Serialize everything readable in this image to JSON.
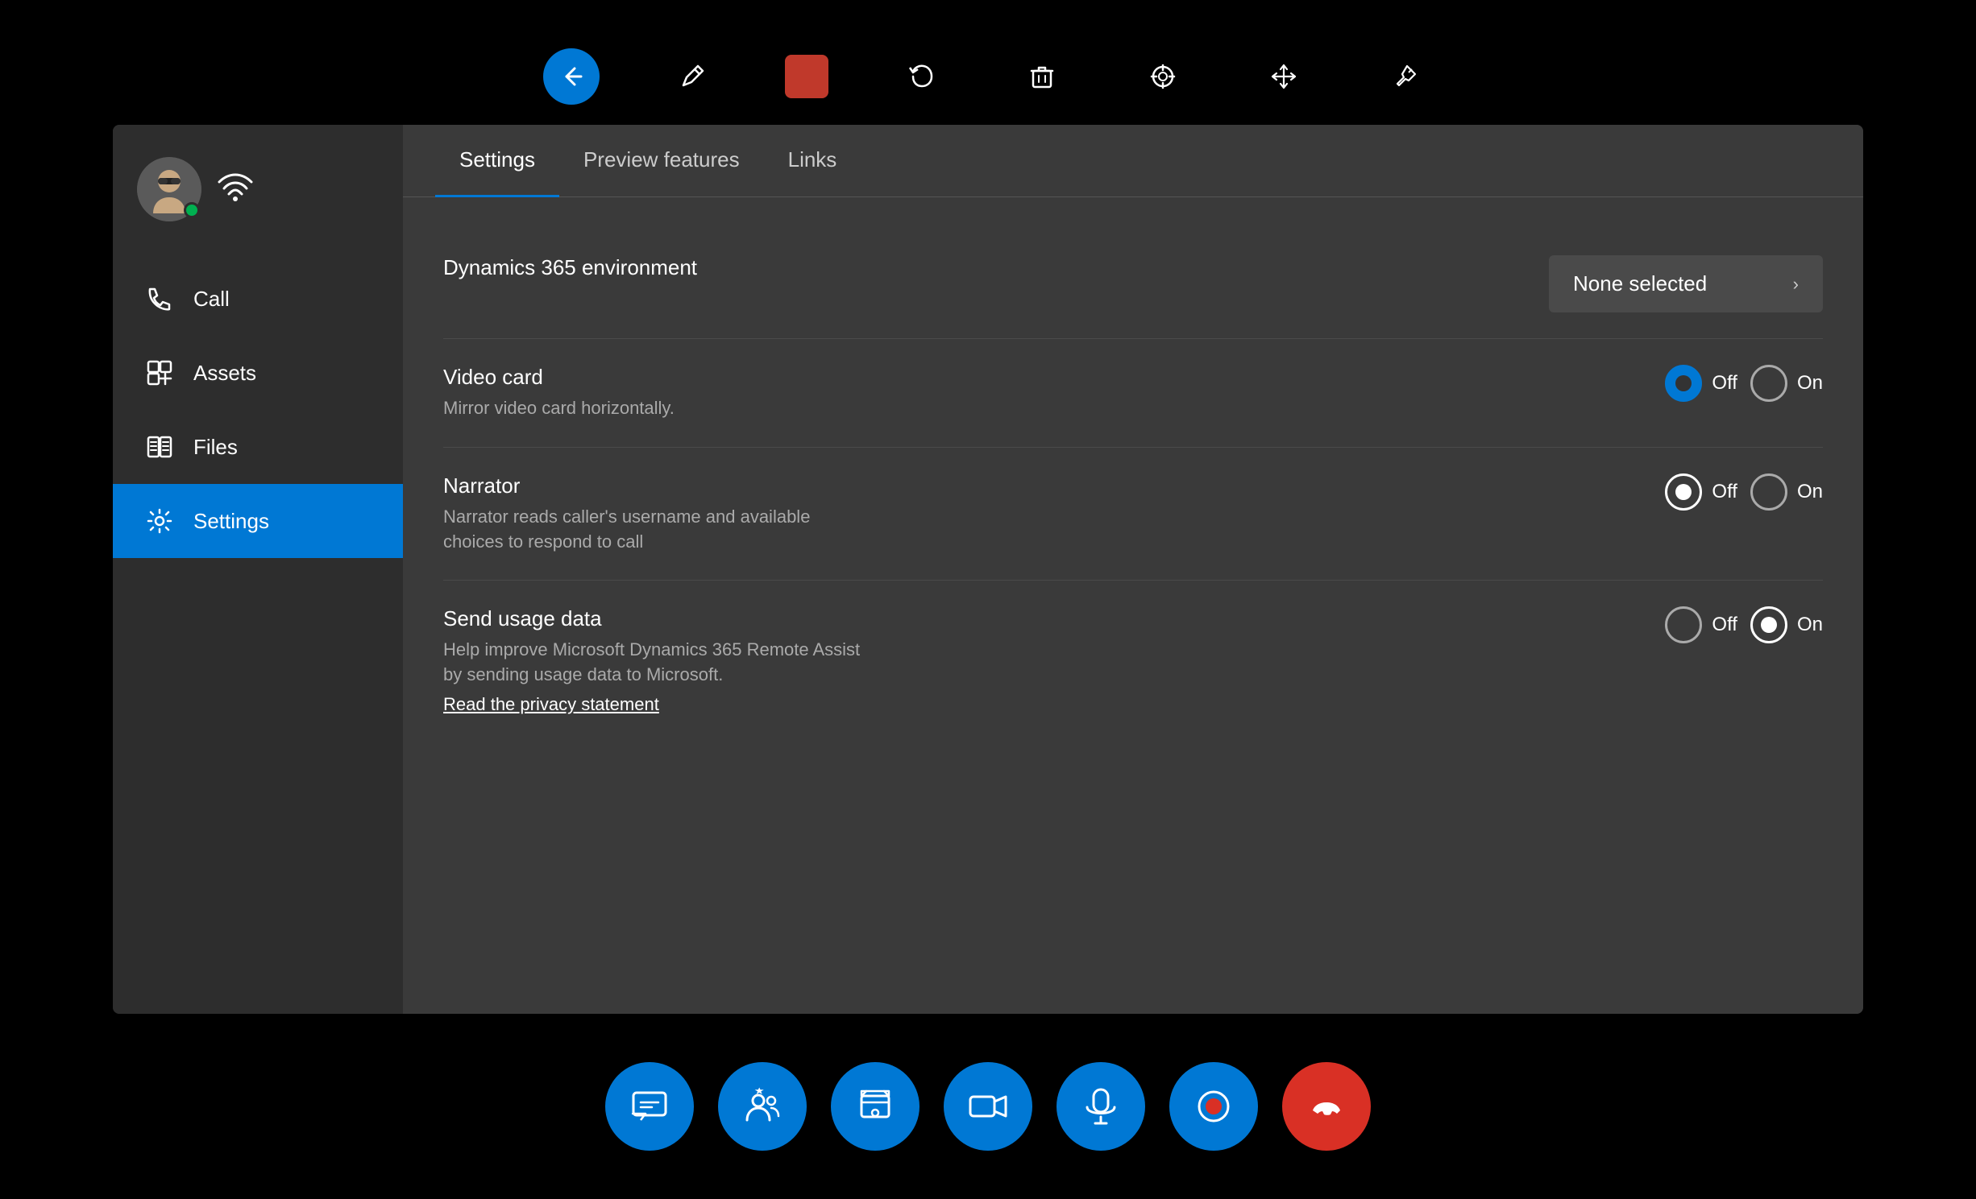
{
  "topToolbar": {
    "buttons": [
      {
        "id": "back",
        "label": "Back",
        "active": true,
        "color": "blue"
      },
      {
        "id": "pen",
        "label": "Pen",
        "active": false,
        "color": "transparent"
      },
      {
        "id": "stop",
        "label": "Stop",
        "active": false,
        "color": "red"
      },
      {
        "id": "undo",
        "label": "Undo",
        "active": false,
        "color": "transparent"
      },
      {
        "id": "delete",
        "label": "Delete",
        "active": false,
        "color": "transparent"
      },
      {
        "id": "target",
        "label": "Target",
        "active": false,
        "color": "transparent"
      },
      {
        "id": "move",
        "label": "Move",
        "active": false,
        "color": "transparent"
      },
      {
        "id": "pin",
        "label": "Pin",
        "active": false,
        "color": "transparent"
      }
    ]
  },
  "sidebar": {
    "userStatus": "online",
    "navItems": [
      {
        "id": "call",
        "label": "Call",
        "active": false
      },
      {
        "id": "assets",
        "label": "Assets",
        "active": false
      },
      {
        "id": "files",
        "label": "Files",
        "active": false
      },
      {
        "id": "settings",
        "label": "Settings",
        "active": true
      }
    ]
  },
  "mainPanel": {
    "tabs": [
      {
        "id": "settings",
        "label": "Settings",
        "active": true
      },
      {
        "id": "preview",
        "label": "Preview features",
        "active": false
      },
      {
        "id": "links",
        "label": "Links",
        "active": false
      }
    ],
    "settings": {
      "environmentLabel": "Dynamics 365 environment",
      "environmentValue": "None selected",
      "videoCard": {
        "title": "Video card",
        "desc": "Mirror video card horizontally.",
        "offSelected": true,
        "onSelected": false
      },
      "narrator": {
        "title": "Narrator",
        "desc": "Narrator reads caller's username and available choices to respond to call",
        "offSelected": true,
        "onSelected": false
      },
      "usageData": {
        "title": "Send usage data",
        "desc": "Help improve Microsoft Dynamics 365 Remote Assist by sending usage data to Microsoft.",
        "offSelected": false,
        "onSelected": true,
        "privacyLink": "Read the privacy statement"
      }
    }
  },
  "bottomToolbar": {
    "buttons": [
      {
        "id": "chat",
        "label": "Chat"
      },
      {
        "id": "participants",
        "label": "Participants"
      },
      {
        "id": "screenshot",
        "label": "Screenshot"
      },
      {
        "id": "video",
        "label": "Video"
      },
      {
        "id": "mic",
        "label": "Microphone"
      },
      {
        "id": "record",
        "label": "Record"
      },
      {
        "id": "end",
        "label": "End call",
        "color": "red"
      }
    ]
  }
}
